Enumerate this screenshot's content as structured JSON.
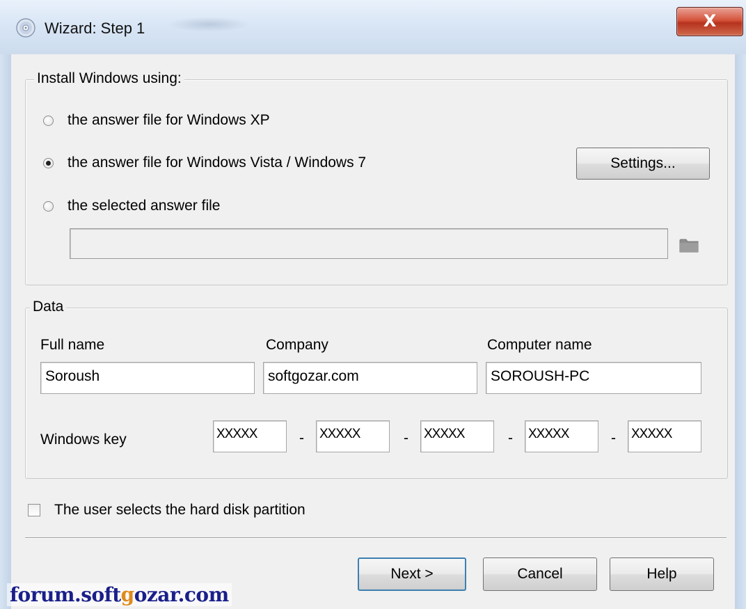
{
  "window": {
    "title": "Wizard: Step 1",
    "close_glyph": "X"
  },
  "install_group": {
    "legend": "Install Windows using:",
    "options": [
      {
        "label": "the answer file for Windows XP",
        "checked": false
      },
      {
        "label": "the answer file for Windows Vista / Windows 7",
        "checked": true
      },
      {
        "label": "the selected answer file",
        "checked": false
      }
    ],
    "settings_button": "Settings...",
    "answer_file_path": ""
  },
  "data_group": {
    "legend": "Data",
    "full_name_label": "Full name",
    "company_label": "Company",
    "computer_name_label": "Computer name",
    "full_name_value": "Soroush",
    "company_value": "softgozar.com",
    "computer_name_value": "SOROUSH-PC",
    "windows_key_label": "Windows key",
    "key_parts": [
      "XXXXX",
      "XXXXX",
      "XXXXX",
      "XXXXX",
      "XXXXX"
    ],
    "key_separator": "-"
  },
  "partition_checkbox": {
    "label": "The user selects the hard disk partition",
    "checked": false
  },
  "footer": {
    "next_button": "Next >",
    "cancel_button": "Cancel",
    "help_button": "Help"
  },
  "watermark": {
    "prefix": "forum.soft",
    "accent": "g",
    "suffix": "ozar.com"
  }
}
